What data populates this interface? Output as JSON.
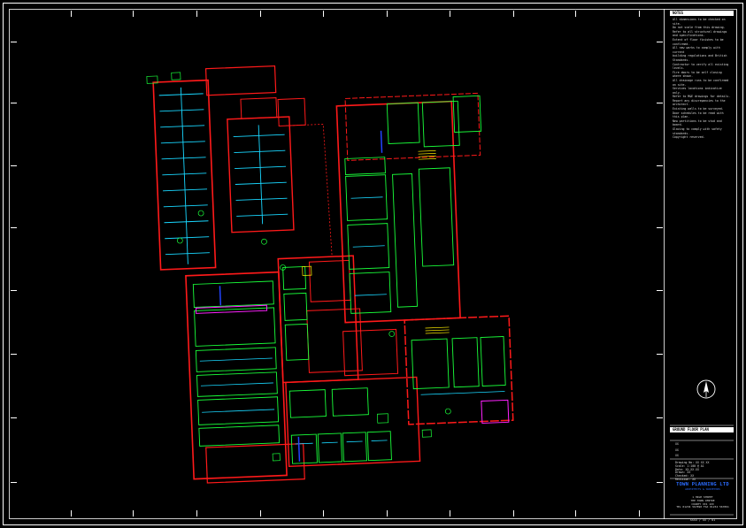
{
  "title_block": {
    "notes_title": "NOTES",
    "notes_lines": [
      "All dimensions to be checked on site.",
      "Do not scale from this drawing.",
      "Refer to all structural drawings and specifications.",
      "Extent of floor finishes to be confirmed.",
      "All new works to comply with current",
      "building regulations and British Standards.",
      "Contractor to verify all existing levels.",
      "Fire doors to be self closing where shown.",
      "All drainage runs to be confirmed on site.",
      "Services locations indicative only.",
      "Refer to M&E drawings for details.",
      "Report any discrepancies to the architect.",
      "Existing walls to be surveyed.",
      "Door schedules to be read with this plan.",
      "New partitions to be stud and board.",
      "Glazing to comply with safety standards.",
      "Copyright reserved."
    ],
    "plan_title": "GROUND FLOOR PLAN",
    "revision_marks": [
      "XX",
      "XX",
      "XX"
    ],
    "details_lines": [
      "Drawing No:   XX XX XX",
      "Scale:        1:100 @ A1",
      "Date:         XX.XX.XX",
      "Drawn:        XX",
      "Checked:      XX",
      "Revision:     XX"
    ],
    "company_name": "TOWN PLANNING LTD",
    "company_sub": "ARCHITECTS & SURVEYORS",
    "address_lines": [
      "1 HIGH STREET",
      "THE TOWN CENTRE",
      "COUNTY XX1 1XX",
      "TEL 01234 567890  FAX 01234 567891"
    ],
    "drawing_number": "XXXX / XX / 01"
  },
  "colors": {
    "background": "#000000",
    "border": "#ffffff",
    "walls": "#ff1a1a",
    "partitions": "#1aff3a",
    "glazing": "#19d7ff",
    "fittings": "#ffee00",
    "special": "#ff22ff",
    "services": "#2244ff",
    "company": "#2b6cff"
  },
  "icons": [
    "north-arrow-icon"
  ]
}
